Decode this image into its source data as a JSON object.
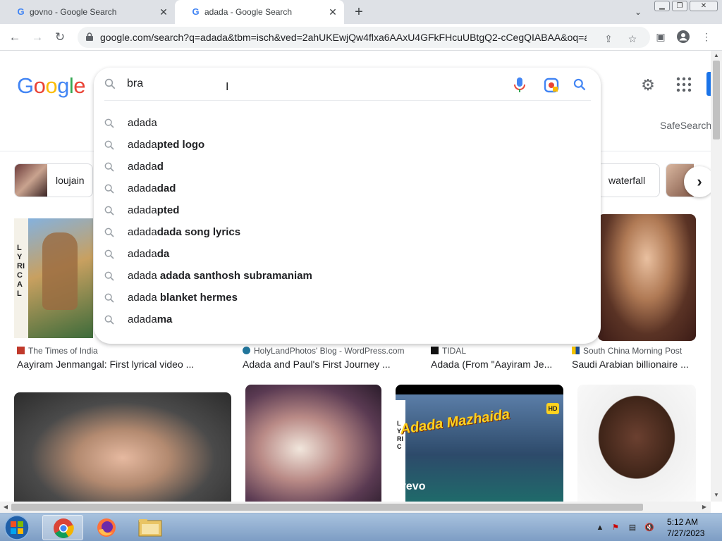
{
  "browser": {
    "tabs": [
      {
        "title": "govno - Google Search",
        "active": false
      },
      {
        "title": "adada - Google Search",
        "active": true
      }
    ],
    "url": "google.com/search?q=adada&tbm=isch&ved=2ahUKEwjQw4flxa6AAxU4GFkFHcuUBtgQ2-cCegQIABAA&oq=ad..."
  },
  "search": {
    "logo": "Google",
    "query": "bra",
    "suggestions": [
      {
        "plain": "adada",
        "bold": ""
      },
      {
        "plain": "adada",
        "bold": "pted logo"
      },
      {
        "plain": "adada",
        "bold": "d"
      },
      {
        "plain": "adada",
        "bold": "dad"
      },
      {
        "plain": "adada",
        "bold": "pted"
      },
      {
        "plain": "adada",
        "bold": "dada song lyrics"
      },
      {
        "plain": "adada",
        "bold": "da"
      },
      {
        "plain": "adada ",
        "bold": "adada santhosh subramaniam"
      },
      {
        "plain": "adada ",
        "bold": "blanket hermes"
      },
      {
        "plain": "adada",
        "bold": "ma"
      }
    ]
  },
  "header": {
    "safesearch": "SafeSearch"
  },
  "chips": [
    {
      "label": "loujain"
    },
    {
      "label": "waterfall"
    }
  ],
  "results_row1": [
    {
      "source": "The Times of India",
      "caption": "Aayiram Jenmangal: First lyrical video ...",
      "side_text": "LYRICAL"
    },
    {
      "source": "HolyLandPhotos' Blog - WordPress.com",
      "caption": "Adada and Paul's First Journey ..."
    },
    {
      "source": "TIDAL",
      "caption": "Adada (From \"Aayiram Je..."
    },
    {
      "source": "South China Morning Post",
      "caption": "Saudi Arabian billionaire ..."
    }
  ],
  "results_row2": [
    {
      "overlay": ""
    },
    {
      "overlay": ""
    },
    {
      "overlay": "Adada Mazhaida",
      "side_text": "LYRIC",
      "brand": "vevo",
      "badge": "HD"
    },
    {
      "overlay": ""
    }
  ],
  "taskbar": {
    "time": "5:12 AM",
    "date": "7/27/2023"
  },
  "colors": {
    "google_blue": "#4285f4",
    "google_red": "#ea4335",
    "google_yellow": "#fbbc05",
    "google_green": "#34a853"
  }
}
